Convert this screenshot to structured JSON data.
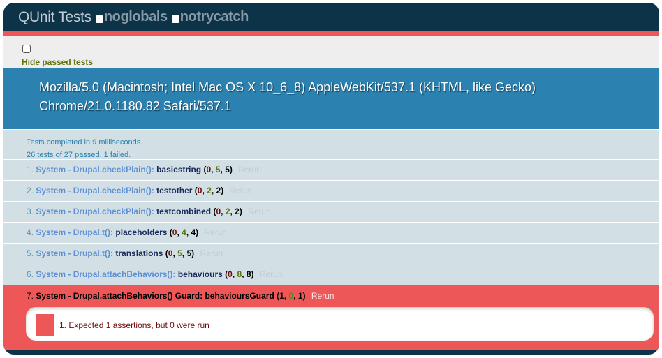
{
  "header": {
    "title": "QUnit Tests",
    "options": [
      {
        "label": "noglobals"
      },
      {
        "label": "notrycatch"
      }
    ]
  },
  "banner": {
    "hide_passed_label": "Hide passed tests"
  },
  "useragent": {
    "line1": "Mozilla/5.0 (Macintosh; Intel Mac OS X 10_6_8) AppleWebKit/537.1 (KHTML, like Gecko)",
    "line2": "Chrome/21.0.1180.82 Safari/537.1"
  },
  "testresult": {
    "completed": "Tests completed in 9 milliseconds.",
    "summary": "26 tests of 27 passed, 1 failed."
  },
  "tests": [
    {
      "num": "1.",
      "module": "System - Drupal.checkPlain():",
      "name": "basicstring",
      "failed": "0",
      "passed": "5",
      "total": "5",
      "rerun": "Rerun"
    },
    {
      "num": "2.",
      "module": "System - Drupal.checkPlain():",
      "name": "testother",
      "failed": "0",
      "passed": "2",
      "total": "2",
      "rerun": "Rerun"
    },
    {
      "num": "3.",
      "module": "System - Drupal.checkPlain():",
      "name": "testcombined",
      "failed": "0",
      "passed": "2",
      "total": "2",
      "rerun": "Rerun"
    },
    {
      "num": "4.",
      "module": "System - Drupal.t():",
      "name": "placeholders",
      "failed": "0",
      "passed": "4",
      "total": "4",
      "rerun": "Rerun"
    },
    {
      "num": "5.",
      "module": "System - Drupal.t():",
      "name": "translations",
      "failed": "0",
      "passed": "5",
      "total": "5",
      "rerun": "Rerun"
    },
    {
      "num": "6.",
      "module": "System - Drupal.attachBehaviors():",
      "name": "behaviours",
      "failed": "0",
      "passed": "8",
      "total": "8",
      "rerun": "Rerun"
    },
    {
      "num": "7.",
      "module": "System - Drupal.attachBehaviors() Guard:",
      "name": "behavioursGuard",
      "failed": "1",
      "passed": "0",
      "total": "1",
      "rerun": "Rerun",
      "assertion": {
        "num": "1.",
        "message": "Expected 1 assertions, but 0 were run"
      }
    }
  ],
  "colors": {
    "header_bg": "#0d3349",
    "fail_red": "#ee5757",
    "useragent_blue": "#2b81af",
    "pass_row_bg": "#d2e0e6",
    "pass_green": "#5e740b"
  }
}
